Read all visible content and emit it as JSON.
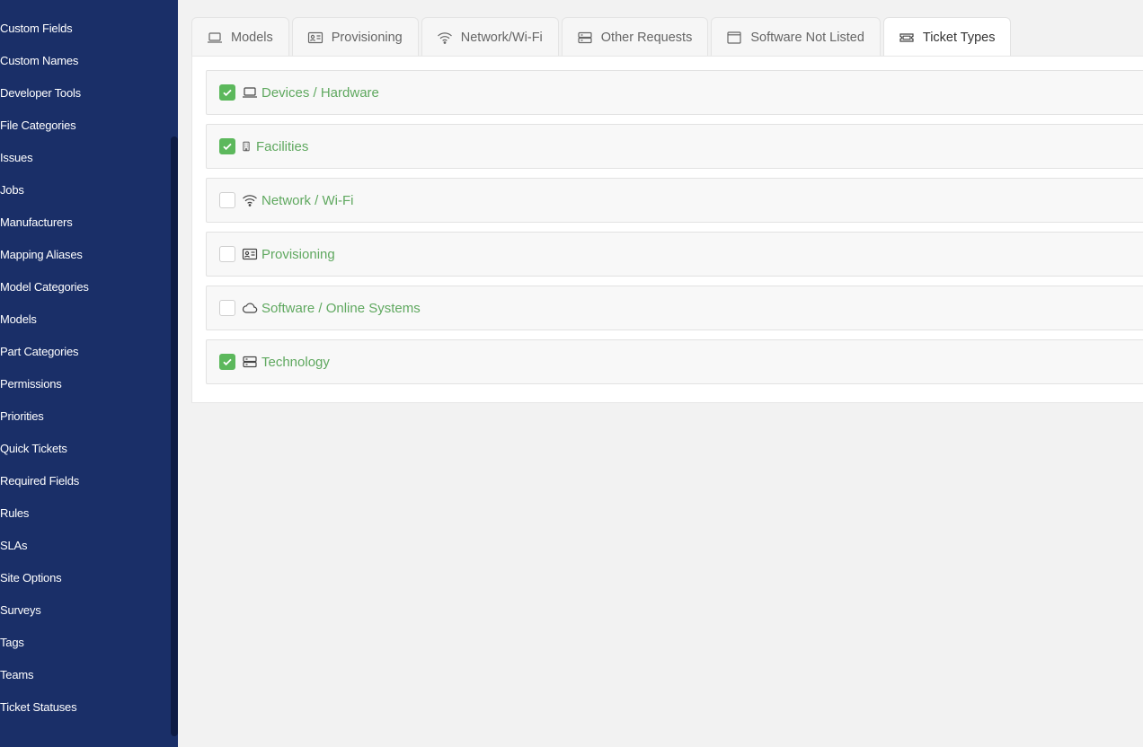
{
  "sidebar": {
    "items": [
      {
        "label": "Custom Fields"
      },
      {
        "label": "Custom Names"
      },
      {
        "label": "Developer Tools"
      },
      {
        "label": "File Categories"
      },
      {
        "label": "Issues"
      },
      {
        "label": "Jobs"
      },
      {
        "label": "Manufacturers"
      },
      {
        "label": "Mapping Aliases"
      },
      {
        "label": "Model Categories"
      },
      {
        "label": "Models"
      },
      {
        "label": "Part Categories"
      },
      {
        "label": "Permissions"
      },
      {
        "label": "Priorities"
      },
      {
        "label": "Quick Tickets"
      },
      {
        "label": "Required Fields"
      },
      {
        "label": "Rules"
      },
      {
        "label": "SLAs"
      },
      {
        "label": "Site Options"
      },
      {
        "label": "Surveys"
      },
      {
        "label": "Tags"
      },
      {
        "label": "Teams"
      },
      {
        "label": "Ticket Statuses"
      }
    ]
  },
  "tabs": [
    {
      "label": "Models",
      "icon": "laptop-icon",
      "active": false
    },
    {
      "label": "Provisioning",
      "icon": "id-card-icon",
      "active": false
    },
    {
      "label": "Network/Wi-Fi",
      "icon": "wifi-icon",
      "active": false
    },
    {
      "label": "Other Requests",
      "icon": "server-icon",
      "active": false
    },
    {
      "label": "Software Not Listed",
      "icon": "window-icon",
      "active": false
    },
    {
      "label": "Ticket Types",
      "icon": "ticket-icon",
      "active": true
    }
  ],
  "ticket_types": [
    {
      "label": "Devices / Hardware",
      "icon": "laptop-icon",
      "checked": true
    },
    {
      "label": "Facilities",
      "icon": "building-icon",
      "checked": true
    },
    {
      "label": "Network / Wi-Fi",
      "icon": "wifi-icon",
      "checked": false
    },
    {
      "label": "Provisioning",
      "icon": "id-card-icon",
      "checked": false
    },
    {
      "label": "Software / Online Systems",
      "icon": "cloud-icon",
      "checked": false
    },
    {
      "label": "Technology",
      "icon": "server-icon",
      "checked": true
    }
  ],
  "colors": {
    "sidebar_bg": "#1a2f68",
    "accent_green": "#5cb85c",
    "label_green": "#5fa85f"
  }
}
